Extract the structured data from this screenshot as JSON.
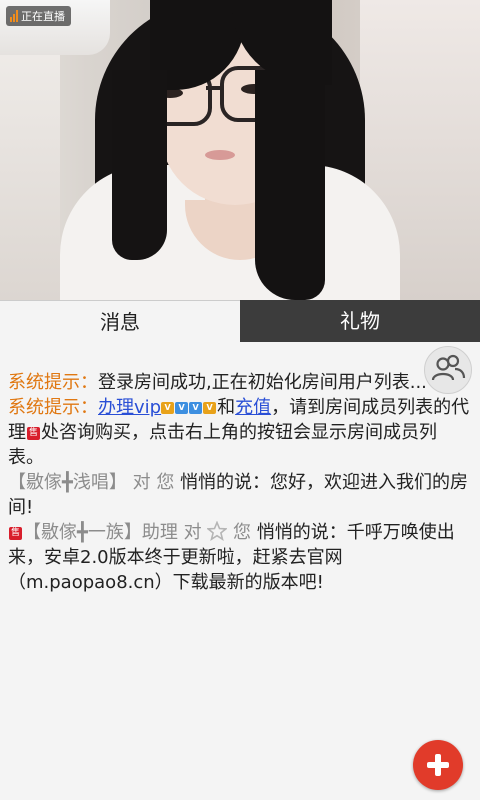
{
  "video": {
    "live_label": "正在直播",
    "colors": {
      "live_accent": "#f08c1c"
    }
  },
  "tabs": [
    {
      "label": "消息",
      "active": true
    },
    {
      "label": "礼物",
      "active": false
    }
  ],
  "chat": {
    "line1": {
      "sys_label": "系统提示：",
      "text": "登录房间成功,正在初始化房间用户列表..."
    },
    "line2": {
      "sys_label": "系统提示：",
      "link_vip": "办理vip",
      "vip_badges": [
        "V",
        "V",
        "V",
        "V"
      ],
      "mid_text": "和",
      "link_recharge": "充值",
      "text_a": "，请到房间成员列表的代理",
      "badge_char": "售",
      "text_b": "处咨询购买，点击右上角的按钮会显示房间成员列表。"
    },
    "line3": {
      "nick": "【敭傢╋浅唱】",
      "to_label": "对",
      "target": "您",
      "verb": "悄悄的说：",
      "text": "您好，欢迎进入我们的房间!"
    },
    "line4": {
      "badge_char": "售",
      "nick": "【敭傢╋一族】助理",
      "to_label": "对",
      "target": "您",
      "verb": "悄悄的说：",
      "text": "千呼万唤使出来，安卓2.0版本终于更新啦，赶紧去官网（m.paopao8.cn）下载最新的版本吧!"
    }
  },
  "colors": {
    "system": "#e07812",
    "link": "#2a4fd6",
    "badge": "#d81e2c",
    "fab": "#e13b2a",
    "tab_inactive_bg": "#3c3c3c"
  },
  "icons": {
    "live": "signal-bars-icon",
    "members": "people-icon",
    "fab": "plus-icon"
  }
}
